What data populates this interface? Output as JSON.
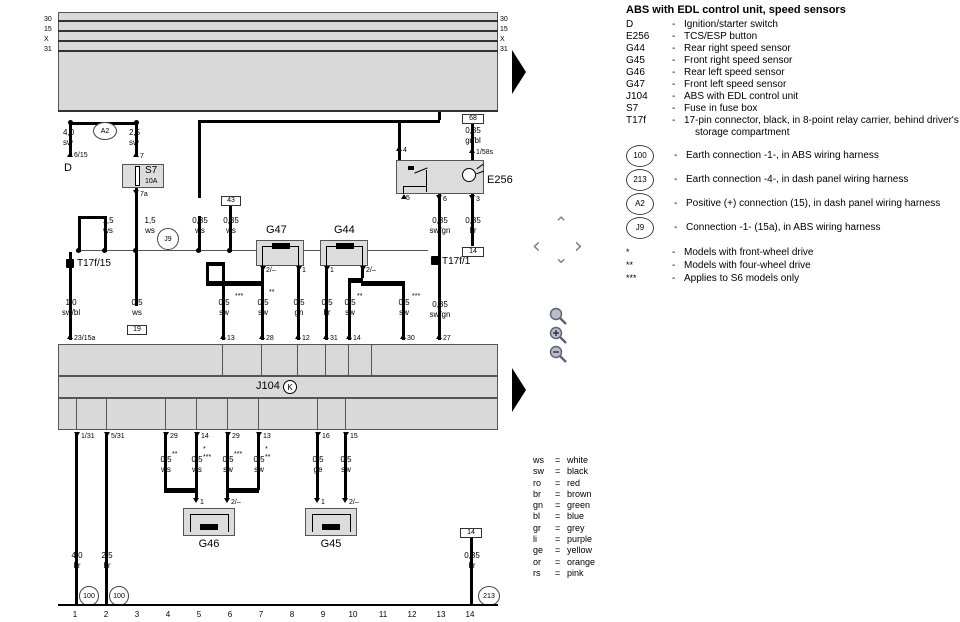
{
  "legend": {
    "title": "ABS with EDL control unit, speed sensors",
    "components": [
      {
        "key": "D",
        "text": "Ignition/starter switch"
      },
      {
        "key": "E256",
        "text": "TCS/ESP button"
      },
      {
        "key": "G44",
        "text": "Rear right speed sensor"
      },
      {
        "key": "G45",
        "text": "Front right speed sensor"
      },
      {
        "key": "G46",
        "text": "Rear left speed sensor"
      },
      {
        "key": "G47",
        "text": "Front left speed sensor"
      },
      {
        "key": "J104",
        "text": "ABS with EDL control unit"
      },
      {
        "key": "S7",
        "text": "Fuse in fuse box"
      },
      {
        "key": "T17f",
        "text": "17-pin connector, black, in 8-point relay carrier, behind driver's",
        "cont": "storage compartment"
      }
    ],
    "connections": [
      {
        "badge": "100",
        "text": "Earth connection -1-, in ABS wiring harness"
      },
      {
        "badge": "213",
        "text": "Earth connection -4-, in dash panel wiring harness"
      },
      {
        "badge": "A2",
        "text": "Positive (+) connection (15), in dash panel wiring harness"
      },
      {
        "badge": "J9",
        "text": "Connection -1- (15a), in ABS wiring harness"
      }
    ],
    "footnotes": [
      {
        "mark": "*",
        "text": "Models with front-wheel drive"
      },
      {
        "mark": "**",
        "text": "Models with four-wheel drive"
      },
      {
        "mark": "***",
        "text": "Applies to S6 models only"
      }
    ],
    "dash": "-"
  },
  "color_key": [
    {
      "code": "ws",
      "eq": "=",
      "name": "white"
    },
    {
      "code": "sw",
      "eq": "=",
      "name": "black"
    },
    {
      "code": "ro",
      "eq": "=",
      "name": "red"
    },
    {
      "code": "br",
      "eq": "=",
      "name": "brown"
    },
    {
      "code": "gn",
      "eq": "=",
      "name": "green"
    },
    {
      "code": "bl",
      "eq": "=",
      "name": "blue"
    },
    {
      "code": "gr",
      "eq": "=",
      "name": "grey"
    },
    {
      "code": "li",
      "eq": "=",
      "name": "purple"
    },
    {
      "code": "ge",
      "eq": "=",
      "name": "yellow"
    },
    {
      "code": "or",
      "eq": "=",
      "name": "orange"
    },
    {
      "code": "rs",
      "eq": "=",
      "name": "pink"
    }
  ],
  "controls": {
    "nav_up": "⌃",
    "nav_down": "⌄",
    "nav_left": "‹",
    "nav_right": "›",
    "zoom_plain": "zoom-icon",
    "zoom_in": "+",
    "zoom_out": "−"
  },
  "diagram": {
    "bus_labels_left": [
      "30",
      "15",
      "X",
      "31"
    ],
    "bus_labels_right": [
      "30",
      "15",
      "X",
      "31"
    ],
    "components": {
      "ignition": "D",
      "fuse": {
        "name": "S7",
        "rating": "10A",
        "pin_top": "7",
        "pin_bottom": "7a"
      },
      "esp_button": {
        "name": "E256",
        "pins": [
          "4",
          "1/58s",
          "5",
          "6",
          "3"
        ]
      },
      "control_unit": {
        "name": "J104",
        "symbol": "K"
      },
      "sensor_g47": {
        "name": "G47",
        "pins": [
          "2/–",
          "1"
        ]
      },
      "sensor_g44": {
        "name": "G44",
        "pins": [
          "1",
          "2/–"
        ]
      },
      "sensor_g46": {
        "name": "G46",
        "pins": [
          "1",
          "2/–"
        ]
      },
      "sensor_g45": {
        "name": "G45",
        "pins": [
          "1",
          "2/–"
        ]
      }
    },
    "connector_badges": [
      {
        "label": "T17f/15"
      },
      {
        "label": "T17f/1"
      }
    ],
    "splice_badges": [
      "A2",
      "J9",
      "100",
      "100",
      "213"
    ],
    "jump_boxes": [
      "68",
      "43",
      "19",
      "14",
      "14"
    ],
    "top_wires": [
      {
        "size": "4,0",
        "color": "sw",
        "terminal": "6/15"
      },
      {
        "size": "2,5",
        "color": "sw",
        "terminal": "7"
      },
      {
        "size": "0,35",
        "color": "gr/bl",
        "terminal": "1/58s"
      }
    ],
    "mid_wires": [
      {
        "size": "1,5",
        "color": "ws"
      },
      {
        "size": "1,5",
        "color": "ws"
      },
      {
        "size": "0,35",
        "color": "ws"
      },
      {
        "size": "0,35",
        "color": "ws"
      },
      {
        "size": "0,35",
        "color": "sw/gn"
      },
      {
        "size": "0,35",
        "color": "br"
      }
    ],
    "sensor_wires_upper": [
      {
        "size": "1,0",
        "color": "sw/bl",
        "terminal": "23/15a",
        "marks": ""
      },
      {
        "size": "0,5",
        "color": "ws",
        "terminal": "19",
        "marks": ""
      },
      {
        "size": "0,5",
        "color": "sw",
        "terminal": "13",
        "marks": "***"
      },
      {
        "size": "0,5",
        "color": "sw",
        "terminal": "28",
        "marks": "**"
      },
      {
        "size": "0,5",
        "color": "gn",
        "terminal": "12",
        "marks": ""
      },
      {
        "size": "0,5",
        "color": "br",
        "terminal": "31",
        "marks": ""
      },
      {
        "size": "0,5",
        "color": "sw",
        "terminal": "14",
        "marks": "**"
      },
      {
        "size": "0,5",
        "color": "sw",
        "terminal": "30",
        "marks": "***"
      },
      {
        "size": "0,35",
        "color": "sw/gn",
        "terminal": "27",
        "marks": ""
      }
    ],
    "cu_terminals_top": [
      "23/15a",
      "13",
      "28",
      "12",
      "31",
      "14",
      "30",
      "27"
    ],
    "cu_terminals_bottom": [
      "1/31",
      "5/31",
      "29",
      "14",
      "29",
      "13",
      "16",
      "15"
    ],
    "sensor_wires_lower": [
      {
        "size": "4,0",
        "color": "br",
        "marks": ""
      },
      {
        "size": "2,5",
        "color": "br",
        "marks": ""
      },
      {
        "size": "0,5",
        "color": "ws",
        "marks": "**"
      },
      {
        "size": "0,5",
        "color": "ws",
        "marks": "***"
      },
      {
        "size": "0,5",
        "color": "sw",
        "marks": "***"
      },
      {
        "size": "0,5",
        "color": "sw",
        "marks": "**"
      },
      {
        "size": "0,5",
        "color": "ge",
        "marks": ""
      },
      {
        "size": "0,5",
        "color": "sw",
        "marks": ""
      },
      {
        "size": "0,35",
        "color": "br",
        "marks": ""
      }
    ],
    "scale": [
      "1",
      "2",
      "3",
      "4",
      "5",
      "6",
      "7",
      "8",
      "9",
      "10",
      "11",
      "12",
      "13",
      "14"
    ]
  }
}
